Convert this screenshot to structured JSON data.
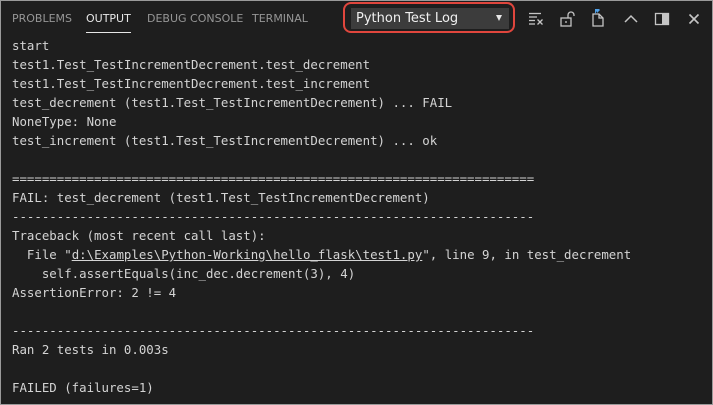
{
  "tabs": [
    {
      "label": "PROBLEMS",
      "active": false
    },
    {
      "label": "OUTPUT",
      "active": true
    },
    {
      "label": "DEBUG CONSOLE",
      "active": false
    },
    {
      "label": "TERMINAL",
      "active": false
    }
  ],
  "channel_select": {
    "selected": "Python Test Log",
    "highlight_color": "#e0463d"
  },
  "actions": [
    {
      "name": "clear-output-icon"
    },
    {
      "name": "lock-scroll-icon"
    },
    {
      "name": "open-log-file-icon"
    },
    {
      "name": "maximize-panel-icon"
    },
    {
      "name": "toggle-panel-layout-icon"
    },
    {
      "name": "close-panel-icon"
    }
  ],
  "output": {
    "lines": [
      "start",
      "test1.Test_TestIncrementDecrement.test_decrement",
      "test1.Test_TestIncrementDecrement.test_increment",
      "test_decrement (test1.Test_TestIncrementDecrement) ... FAIL",
      "NoneType: None",
      "test_increment (test1.Test_TestIncrementDecrement) ... ok",
      "",
      "======================================================================",
      "FAIL: test_decrement (test1.Test_TestIncrementDecrement)",
      "----------------------------------------------------------------------",
      "Traceback (most recent call last):",
      {
        "before": "  File \"",
        "link": "d:\\Examples\\Python-Working\\hello_flask\\test1.py",
        "after": "\", line 9, in test_decrement"
      },
      "    self.assertEquals(inc_dec.decrement(3), 4)",
      "AssertionError: 2 != 4",
      "",
      "----------------------------------------------------------------------",
      "Ran 2 tests in 0.003s",
      "",
      "FAILED (failures=1)"
    ]
  },
  "colors": {
    "background": "#1e1e1e",
    "text": "#d4d4d4",
    "tab_inactive": "#969696",
    "tab_active": "#e7e7e7",
    "select_background": "#3c3c3c"
  }
}
